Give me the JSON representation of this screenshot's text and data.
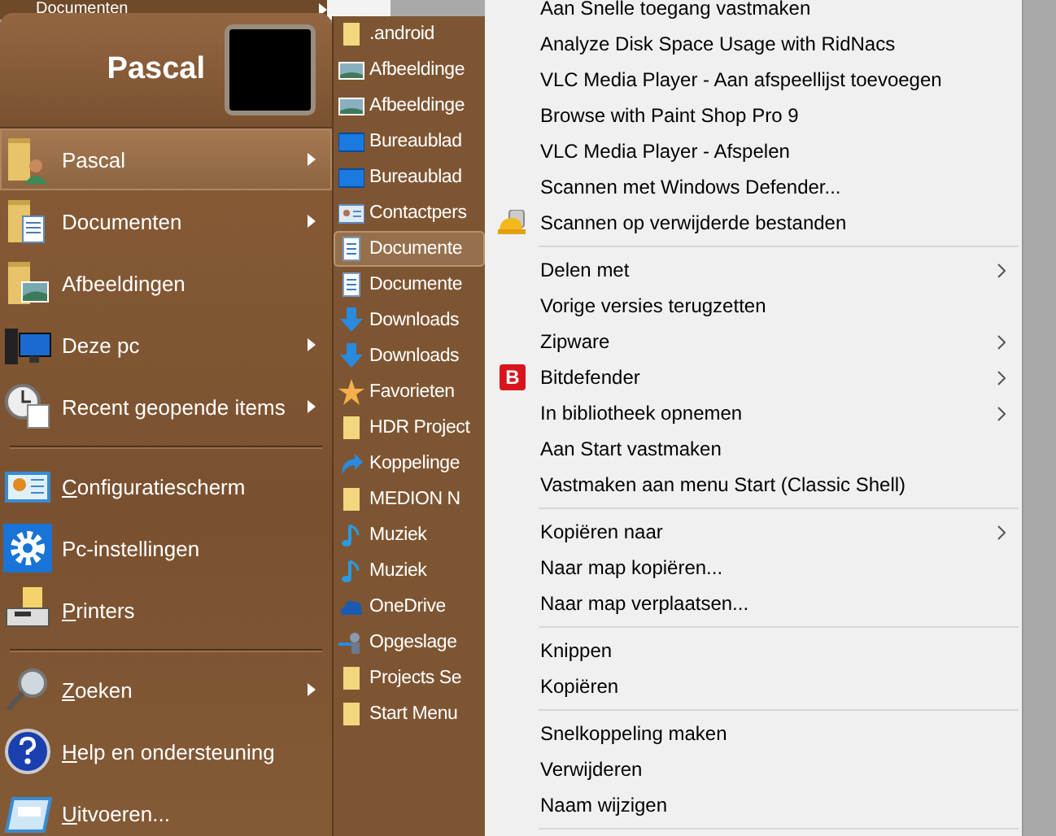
{
  "behind_menu": {
    "label": "Documenten",
    "submenu": true
  },
  "start_menu": {
    "user_name": "Pascal",
    "items": [
      {
        "label": "Pascal",
        "kind": "user-folder",
        "submenu": true,
        "selected": true,
        "accel": false
      },
      {
        "label": "Documenten",
        "kind": "docs-folder",
        "submenu": true,
        "selected": false,
        "accel": false
      },
      {
        "label": "Afbeeldingen",
        "kind": "pictures-folder",
        "submenu": false,
        "selected": false,
        "accel": false
      },
      {
        "label": "Deze pc",
        "kind": "pc",
        "submenu": true,
        "selected": false,
        "accel": false
      },
      {
        "label": "Recent geopende items",
        "kind": "recent",
        "submenu": true,
        "selected": false,
        "accel": false,
        "separator_after": true
      },
      {
        "label": "Configuratiescherm",
        "kind": "control-panel",
        "submenu": false,
        "selected": false,
        "accel": true
      },
      {
        "label": "Pc-instellingen",
        "kind": "gear",
        "submenu": false,
        "selected": false,
        "accel": false
      },
      {
        "label": "Printers",
        "kind": "printer",
        "submenu": false,
        "selected": false,
        "accel": true,
        "separator_after": true
      },
      {
        "label": "Zoeken",
        "kind": "search",
        "submenu": true,
        "selected": false,
        "accel": true
      },
      {
        "label": "Help en ondersteuning",
        "kind": "help",
        "submenu": false,
        "selected": false,
        "accel": true
      },
      {
        "label": "Uitvoeren...",
        "kind": "run",
        "submenu": false,
        "selected": false,
        "accel": true
      }
    ]
  },
  "folder_submenu": {
    "items": [
      {
        "label": ".android",
        "kind": "folder",
        "selected": false
      },
      {
        "label": "Afbeeldinge",
        "kind": "picture",
        "selected": false
      },
      {
        "label": "Afbeeldinge",
        "kind": "picture",
        "selected": false
      },
      {
        "label": "Bureaublad",
        "kind": "desktop",
        "selected": false
      },
      {
        "label": "Bureaublad",
        "kind": "desktop",
        "selected": false
      },
      {
        "label": "Contactpers",
        "kind": "contact",
        "selected": false
      },
      {
        "label": "Documente",
        "kind": "document",
        "selected": true
      },
      {
        "label": "Documente",
        "kind": "document",
        "selected": false
      },
      {
        "label": "Downloads",
        "kind": "download",
        "selected": false
      },
      {
        "label": "Downloads",
        "kind": "download",
        "selected": false
      },
      {
        "label": "Favorieten",
        "kind": "star",
        "selected": false
      },
      {
        "label": "HDR Project",
        "kind": "folder",
        "selected": false
      },
      {
        "label": "Koppelinge",
        "kind": "link",
        "selected": false
      },
      {
        "label": "MEDION N",
        "kind": "folder",
        "selected": false
      },
      {
        "label": "Muziek",
        "kind": "music",
        "selected": false
      },
      {
        "label": "Muziek",
        "kind": "music",
        "selected": false
      },
      {
        "label": "OneDrive",
        "kind": "cloud",
        "selected": false
      },
      {
        "label": "Opgeslage",
        "kind": "saved",
        "selected": false
      },
      {
        "label": "Projects Se",
        "kind": "folder",
        "selected": false
      },
      {
        "label": "Start Menu",
        "kind": "folder",
        "selected": false
      }
    ]
  },
  "context_menu": {
    "groups": [
      [
        {
          "label": "Aan Snelle toegang vastmaken",
          "submenu": false
        },
        {
          "label": "Analyze Disk Space Usage with RidNacs",
          "submenu": false
        },
        {
          "label": "VLC Media Player - Aan afspeellijst toevoegen",
          "submenu": false
        },
        {
          "label": "Browse with Paint Shop Pro 9",
          "submenu": false
        },
        {
          "label": "VLC Media Player - Afspelen",
          "submenu": false
        },
        {
          "label": "Scannen met Windows Defender...",
          "submenu": false
        },
        {
          "label": "Scannen op verwijderde bestanden",
          "submenu": false,
          "kind": "hardhat"
        }
      ],
      [
        {
          "label": "Delen met",
          "submenu": true
        },
        {
          "label": "Vorige versies terugzetten",
          "submenu": false
        },
        {
          "label": "Zipware",
          "submenu": true
        },
        {
          "label": "Bitdefender",
          "submenu": true,
          "kind": "badge",
          "badge": "B"
        },
        {
          "label": "In bibliotheek opnemen",
          "submenu": true
        },
        {
          "label": "Aan Start vastmaken",
          "submenu": false
        },
        {
          "label": "Vastmaken aan menu Start (Classic Shell)",
          "submenu": false
        }
      ],
      [
        {
          "label": "Kopiëren naar",
          "submenu": true
        },
        {
          "label": "Naar map kopiëren...",
          "submenu": false
        },
        {
          "label": "Naar map verplaatsen...",
          "submenu": false
        }
      ],
      [
        {
          "label": "Knippen",
          "submenu": false
        },
        {
          "label": "Kopiëren",
          "submenu": false
        }
      ],
      [
        {
          "label": "Snelkoppeling maken",
          "submenu": false
        },
        {
          "label": "Verwijderen",
          "submenu": false
        },
        {
          "label": "Naam wijzigen",
          "submenu": false
        }
      ]
    ]
  }
}
